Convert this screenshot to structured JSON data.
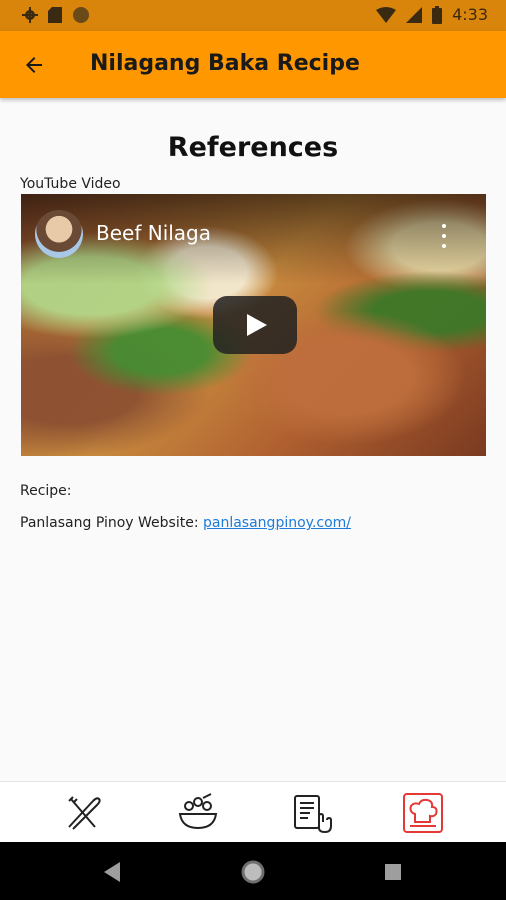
{
  "status_bar": {
    "time": "4:33"
  },
  "app_bar": {
    "title": "Nilagang Baka Recipe"
  },
  "page": {
    "section_title": "References",
    "video_label": "YouTube Video",
    "video": {
      "title": "Beef Nilaga"
    },
    "recipe_label": "Recipe:",
    "recipe_source_label": "Panlasang Pinoy Website: ",
    "recipe_link": "panlasangpinoy.com/"
  },
  "bottom_nav": {
    "items": [
      {
        "icon": "utensils-icon",
        "active": false
      },
      {
        "icon": "ingredients-bowl-icon",
        "active": false
      },
      {
        "icon": "instructions-icon",
        "active": false
      },
      {
        "icon": "chef-references-icon",
        "active": true
      }
    ]
  },
  "colors": {
    "app_bar": "#ff9800",
    "status_bar": "#d9850b",
    "link": "#1e7bd8",
    "active_icon": "#e53935"
  }
}
